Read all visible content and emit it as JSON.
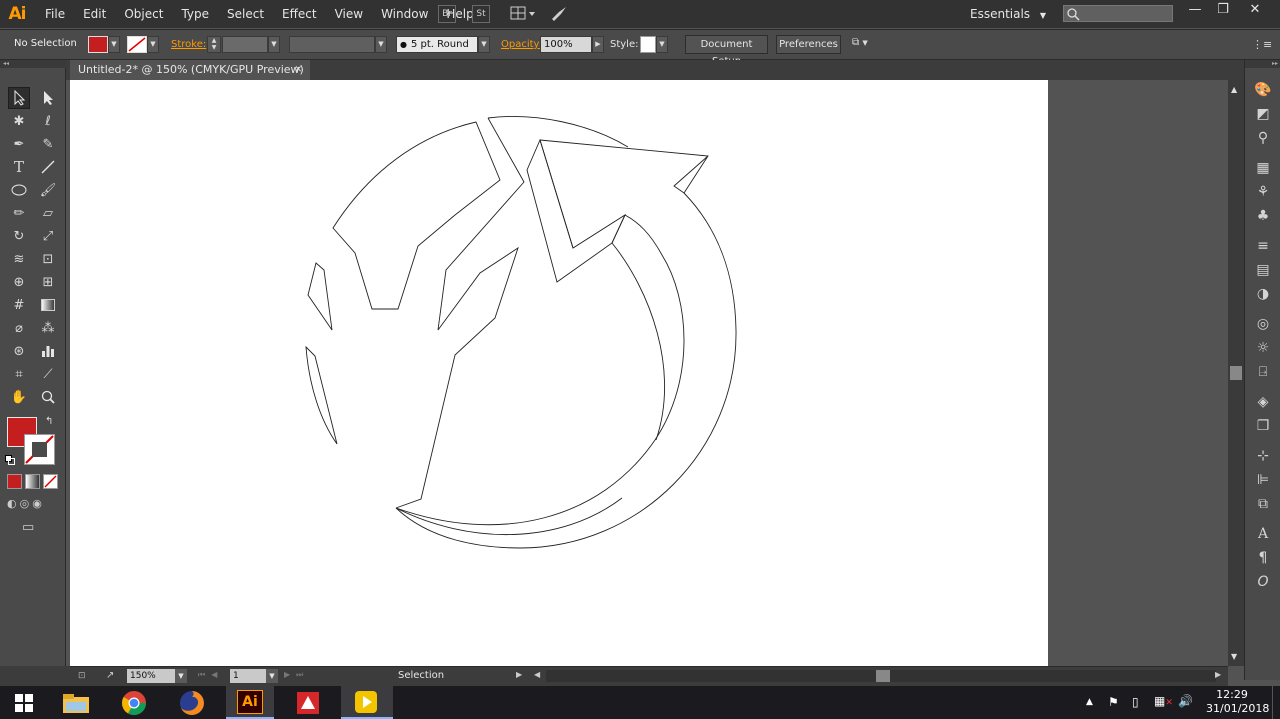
{
  "app": {
    "logo": "Ai"
  },
  "menu": [
    "File",
    "Edit",
    "Object",
    "Type",
    "Select",
    "Effect",
    "View",
    "Window",
    "Help"
  ],
  "menubar_buttons": {
    "bridge": "Br",
    "stock": "St"
  },
  "workspace": {
    "label": "Essentials"
  },
  "window_controls": {
    "minimize": "—",
    "restore": "❐",
    "close": "✕"
  },
  "control": {
    "selection_status": "No Selection",
    "stroke_label": "Stroke:",
    "brush_label": "5 pt. Round",
    "opacity_label": "Opacity:",
    "opacity_value": "100%",
    "style_label": "Style:",
    "document_setup": "Document Setup",
    "preferences": "Preferences"
  },
  "tab": {
    "title": "Untitled-2* @ 150% (CMYK/GPU Preview)",
    "close": "✕"
  },
  "status": {
    "zoom": "150%",
    "artboard": "1",
    "tool": "Selection"
  },
  "taskbar": {
    "time": "12:29",
    "date": "31/01/2018",
    "apps": [
      "file-explorer",
      "chrome",
      "firefox",
      "illustrator",
      "acrobat",
      "media-player"
    ],
    "illustrator_label": "Ai"
  },
  "colors": {
    "fill": "#c41e1e",
    "accent": "#ff9a00",
    "ui_dark": "#323232",
    "ui_mid": "#4a4a4a",
    "canvas": "#ffffff"
  }
}
